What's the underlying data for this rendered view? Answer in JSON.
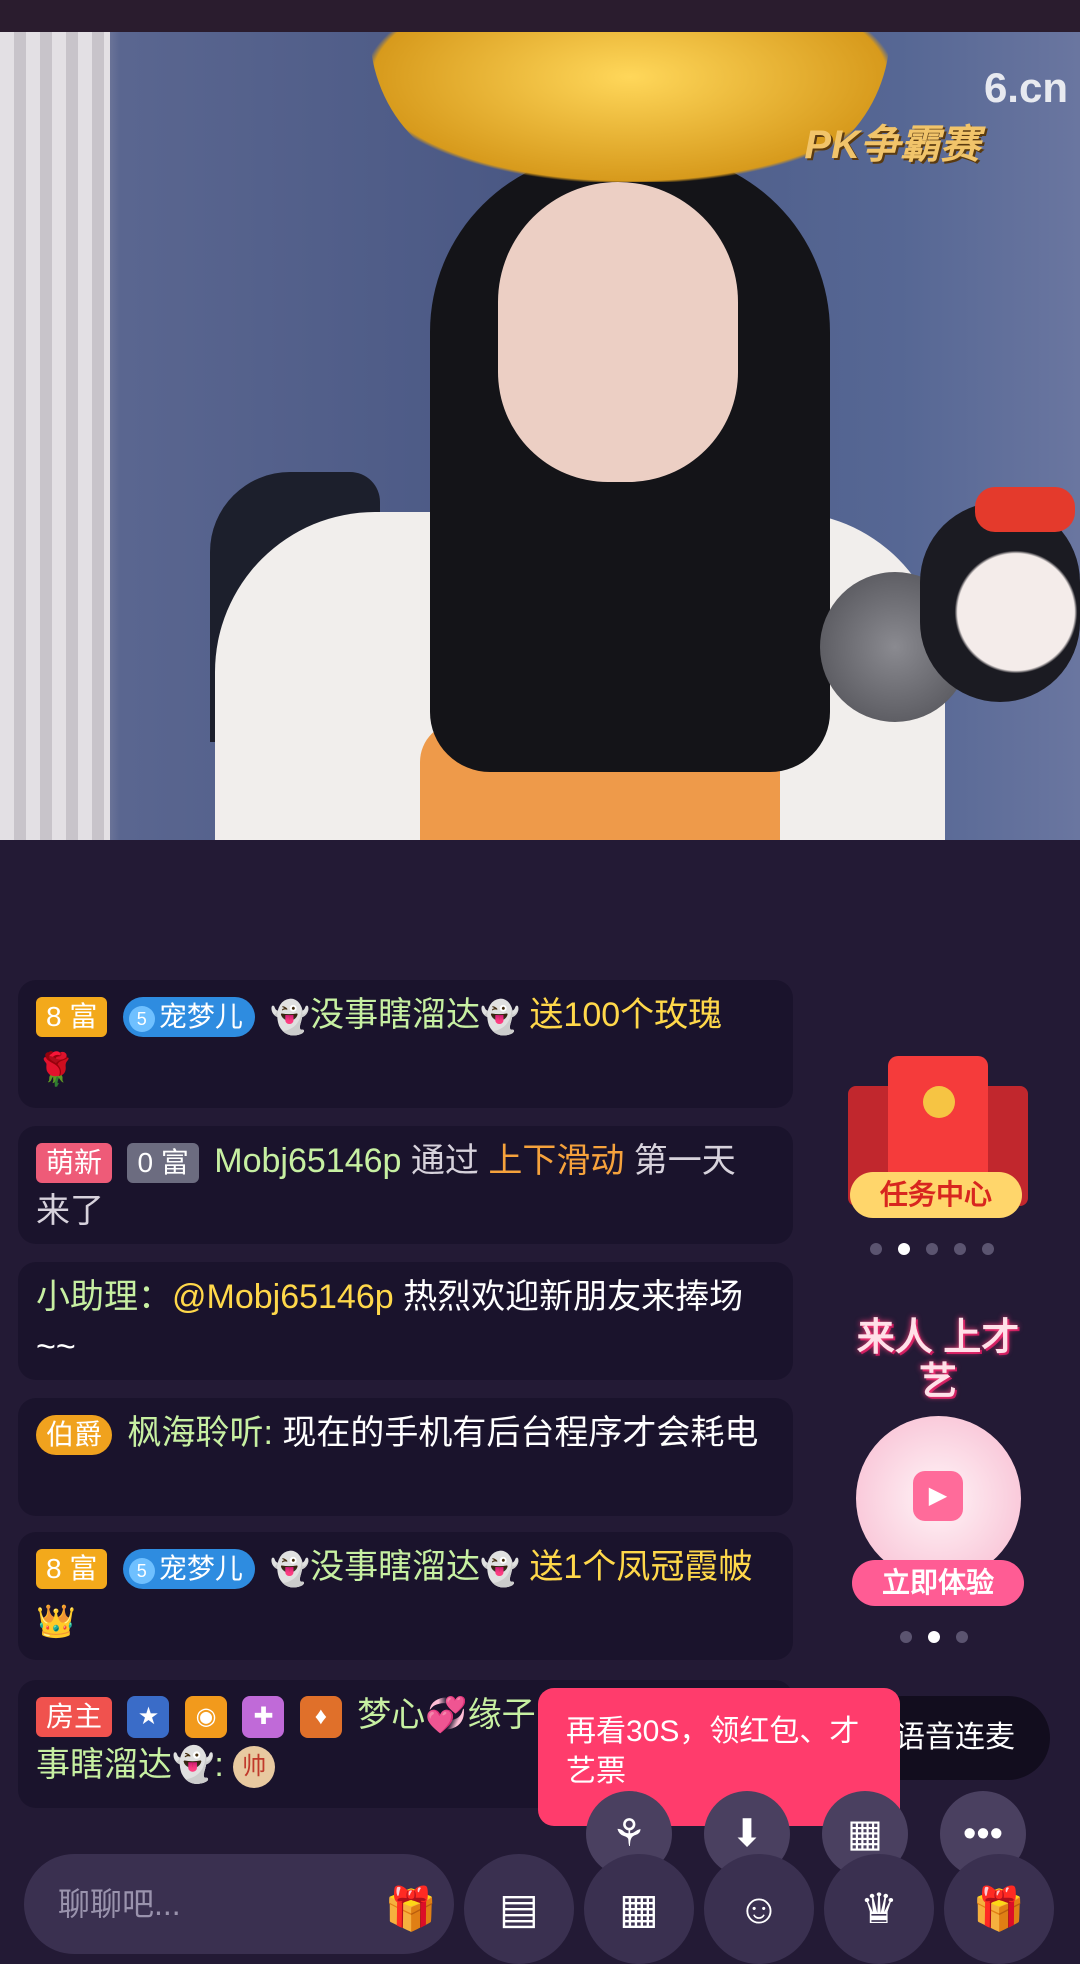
{
  "app": {
    "name": "6.cn live room"
  },
  "stream": {
    "logo_text": "6.cn",
    "event_text": "PK争霸赛"
  },
  "messages": [
    {
      "badge_rich": "8 富",
      "badge_pet_level": "5",
      "badge_pet_name": "宠梦儿",
      "user": "没事瞎溜达",
      "action": "送100个玫瑰"
    },
    {
      "badge_new": "萌新",
      "badge_rich": "0 富",
      "user": "Mobj65146p",
      "text1": "通过",
      "highlight": "上下滑动",
      "text2": "第一天 来了"
    },
    {
      "prefix": "小助理：",
      "mention": "@Mobj65146p",
      "text": "热烈欢迎新朋友来捧场~~"
    },
    {
      "badge_noble": "伯爵",
      "user": "枫海聆听:",
      "text": "现在的手机有后台程序才会耗电"
    },
    {
      "badge_rich": "8 富",
      "badge_pet_level": "5",
      "badge_pet_name": "宠梦儿",
      "user": "没事瞎溜达",
      "action": "送1个凤冠霞帔"
    },
    {
      "badge_host": "房主",
      "user": "梦心💞缘子",
      "text": "事瞎溜达👻:",
      "chess_piece": "帅"
    }
  ],
  "side": {
    "task_center_label": "任务中心",
    "talent_title": "来人 上才艺",
    "talent_button": "立即体验"
  },
  "voice_link_label": "语音连麦",
  "popup_text": "再看30S，领红包、才艺票",
  "chat_placeholder": "聊聊吧..."
}
